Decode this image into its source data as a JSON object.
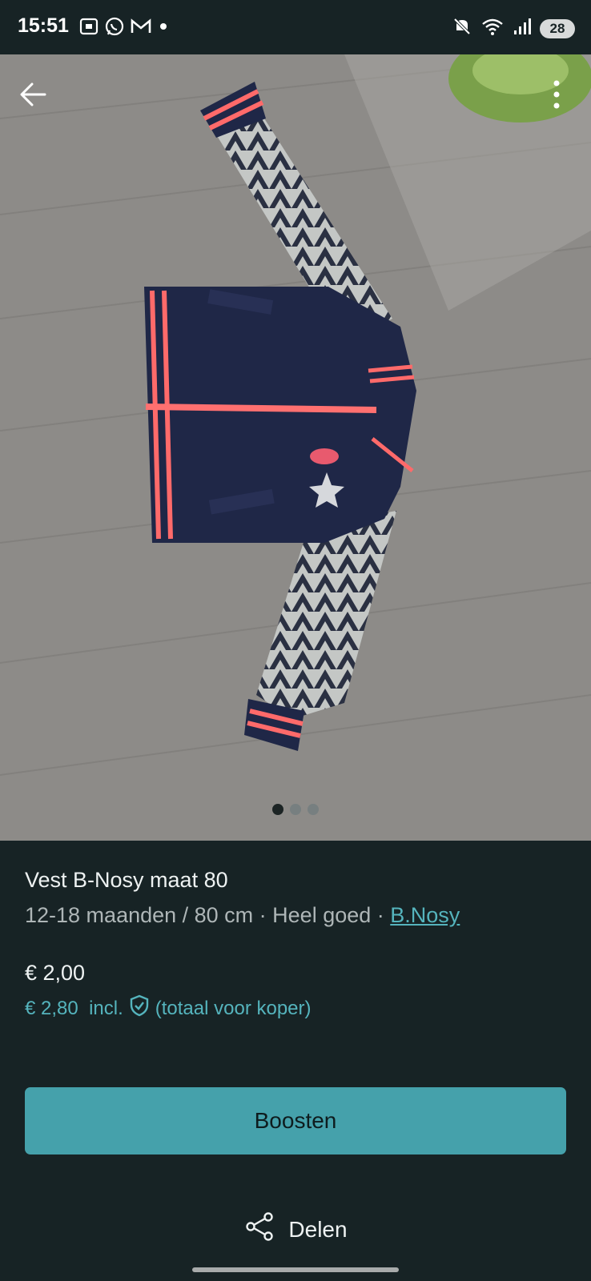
{
  "status": {
    "time": "15:51",
    "battery": "28",
    "left_icons": [
      "screenshot-icon",
      "whatsapp-icon",
      "gmail-icon",
      "notification-dot-icon"
    ],
    "right_icons": [
      "mute-icon",
      "wifi-icon",
      "signal-icon",
      "battery-icon"
    ]
  },
  "gallery": {
    "image_count": 3,
    "active_index": 0
  },
  "item": {
    "title": "Vest B-Nosy maat 80",
    "details": "12-18 maanden / 80 cm · Heel goed · ",
    "brand": "B.Nosy",
    "price": "€ 2,00",
    "price_incl": "€ 2,80  incl.",
    "price_incl_note": "(totaal voor koper)"
  },
  "actions": {
    "boost_label": "Boosten",
    "share_label": "Delen"
  },
  "colors": {
    "background": "#172325",
    "accent": "#45a1ab",
    "link": "#55b4bd"
  }
}
